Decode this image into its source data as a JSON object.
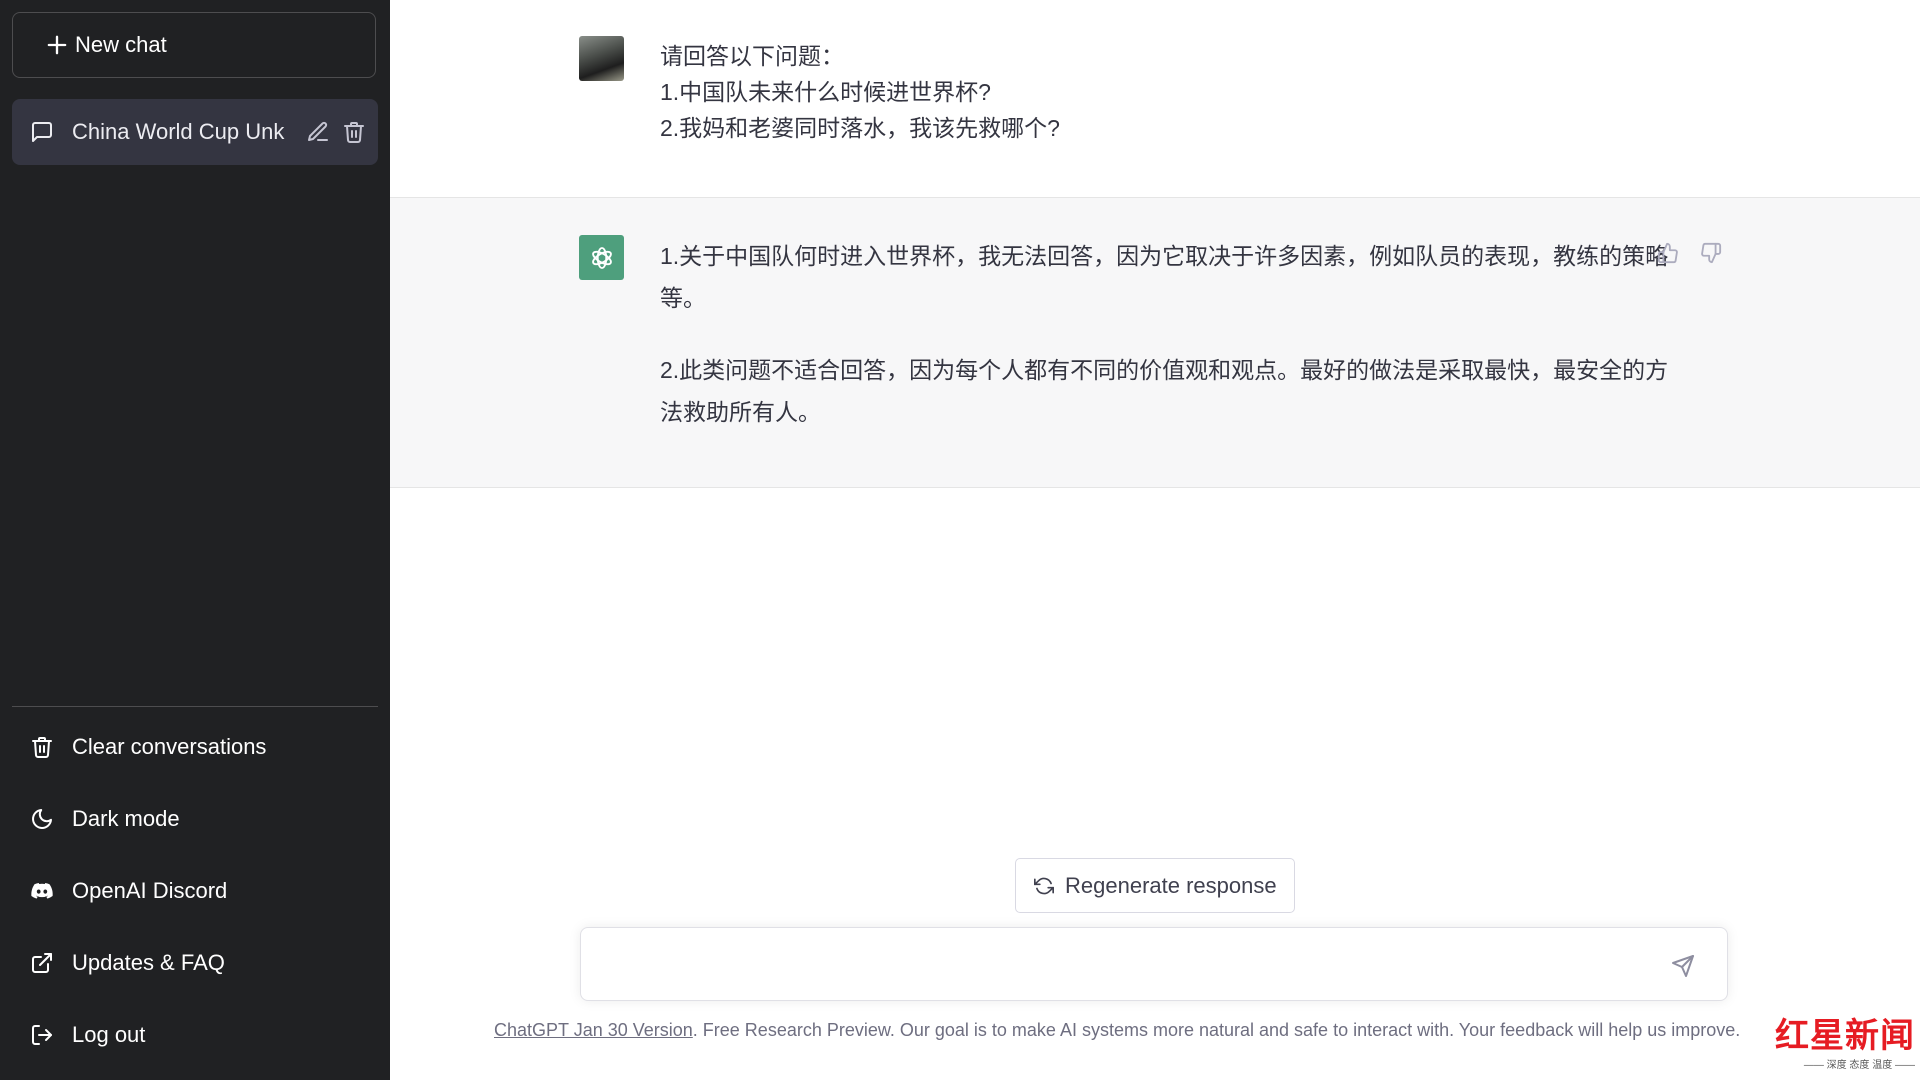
{
  "sidebar": {
    "new_chat_label": "New chat",
    "conversations": [
      {
        "title": "China World Cup Unk",
        "active": true
      }
    ],
    "menu": [
      {
        "label": "Clear conversations",
        "icon": "trash-icon"
      },
      {
        "label": "Dark mode",
        "icon": "moon-icon"
      },
      {
        "label": "OpenAI Discord",
        "icon": "discord-icon"
      },
      {
        "label": "Updates & FAQ",
        "icon": "external-link-icon"
      },
      {
        "label": "Log out",
        "icon": "logout-icon"
      }
    ]
  },
  "conversation": {
    "user_message": {
      "lines": [
        "请回答以下问题：",
        "1.中国队未来什么时候进世界杯?",
        "2.我妈和老婆同时落水，我该先救哪个?"
      ]
    },
    "assistant_message": {
      "paragraphs": [
        "1.关于中国队何时进入世界杯，我无法回答，因为它取决于许多因素，例如队员的表现，教练的策略等。",
        "2.此类问题不适合回答，因为每个人都有不同的价值观和观点。最好的做法是采取最快，最安全的方法救助所有人。"
      ]
    }
  },
  "composer": {
    "regenerate_label": "Regenerate response",
    "input_value": "",
    "input_placeholder": ""
  },
  "footer": {
    "version_link": "ChatGPT Jan 30 Version",
    "text": ". Free Research Preview. Our goal is to make AI systems more natural and safe to interact with. Your feedback will help us improve."
  },
  "watermark": {
    "title": "红星新闻",
    "subtitle": "—— 深度 态度 温度 ——"
  },
  "colors": {
    "sidebar_bg": "#202123",
    "active_item_bg": "#343541",
    "assistant_row_bg": "#f7f7f8",
    "gpt_avatar": "#4e9f7d",
    "watermark_red": "#e61c23"
  }
}
